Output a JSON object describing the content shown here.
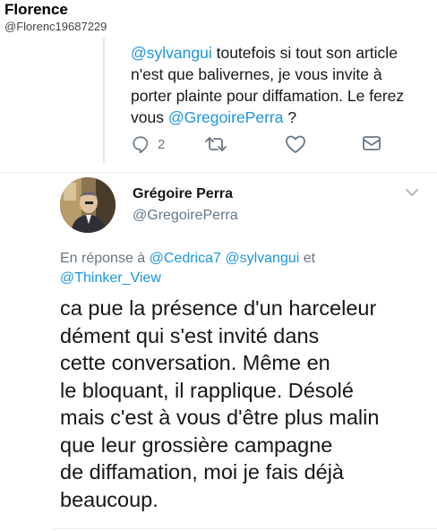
{
  "poster": {
    "name": "Florence",
    "handle": "@Florenc19687229"
  },
  "reply_tweet": {
    "mention1": "@sylvangui",
    "text1": " toutefois si tout son article",
    "line2": "n'est que balivernes, je vous invite à",
    "line3": "porter plainte pour diffamation. Le ferez",
    "line4_pre": "vous ",
    "mention2": "@GregoirePerra",
    "line4_post": " ?",
    "reply_count": "2",
    "icons": [
      "reply-icon",
      "retweet-icon",
      "like-icon",
      "message-icon"
    ]
  },
  "main_tweet": {
    "author_name": "Grégoire Perra",
    "author_handle": "@GregoirePerra",
    "in_reply_prefix": "En réponse à ",
    "in_reply_mention1": "@Cedrica7",
    "in_reply_mention2": "@sylvangui",
    "in_reply_conj": " et",
    "in_reply_mention3": "@Thinker_View",
    "lines": [
      "ca pue la présence d'un harceleur",
      "dément qui s'est invité dans",
      "cette conversation. Même en",
      "le bloquant, il rapplique. Désolé",
      "mais c'est à vous d'être plus malin",
      "que leur grossière campagne",
      "de diffamation, moi je fais déjà",
      "beaucoup."
    ]
  },
  "colors": {
    "link": "#1b95e0",
    "secondary": "#657786",
    "text": "#14171a"
  }
}
